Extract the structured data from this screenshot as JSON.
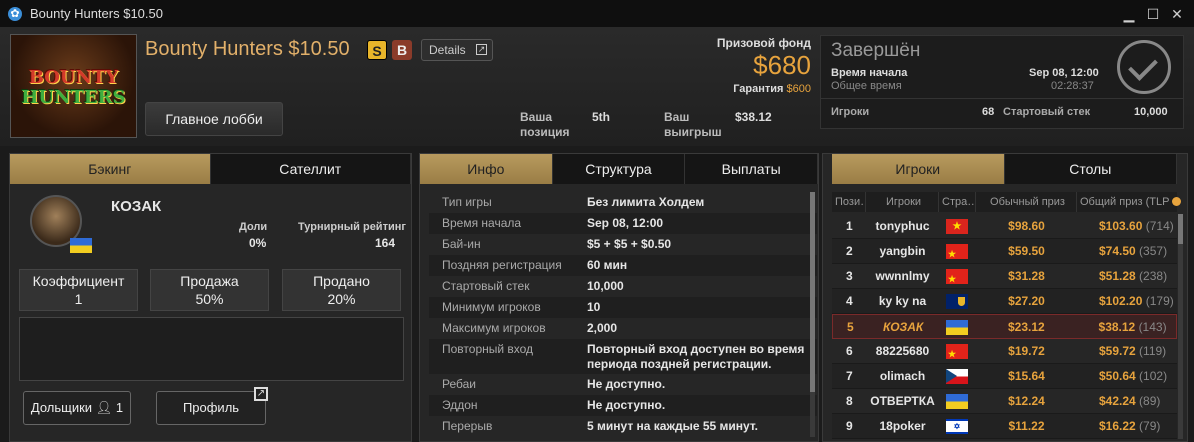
{
  "window": {
    "title": "Bounty Hunters $10.50",
    "minimize": "▁",
    "maximize": "☐",
    "close": "✕"
  },
  "logo": {
    "line1": "BOUNTY",
    "line2": "HUNTERS"
  },
  "header": {
    "tournament_name": "Bounty Hunters $10.50",
    "badge_s": "S",
    "badge_b": "B",
    "details_label": "Details",
    "lobby_button": "Главное лобби",
    "position_label_1": "Ваша",
    "position_label_2": "позиция",
    "position_value": "5th",
    "winnings_label_1": "Ваш",
    "winnings_label_2": "выигрыш",
    "winnings_value": "$38.12",
    "prize_label": "Призовой фонд",
    "prize_value": "$680",
    "guarantee_label": "Гарантия",
    "guarantee_value": "$600"
  },
  "status": {
    "title": "Завершён",
    "start_label": "Время начала",
    "start_value": "Sep 08, 12:00",
    "total_label": "Общее время",
    "total_value": "02:28:37",
    "players_label": "Игроки",
    "players_value": "68",
    "stack_label": "Стартовый стек",
    "stack_value": "10,000"
  },
  "left_panel": {
    "tabs": [
      "Бэкинг",
      "Сателлит"
    ],
    "player_name": "КОЗАК",
    "shares_label": "Доли",
    "shares_value": "0%",
    "rating_label": "Турнирный рейтинг",
    "rating_value": "164",
    "stats": [
      {
        "label": "Коэффициент",
        "value": "1"
      },
      {
        "label": "Продажа",
        "value": "50%"
      },
      {
        "label": "Продано",
        "value": "20%"
      }
    ],
    "backers_button": "Дольщики",
    "backers_count": "1",
    "profile_button": "Профиль"
  },
  "mid_panel": {
    "tabs": [
      "Инфо",
      "Структура",
      "Выплаты"
    ],
    "rows": [
      {
        "k": "Тип игры",
        "v": "Без лимита Холдем"
      },
      {
        "k": "Время начала",
        "v": "Sep 08, 12:00"
      },
      {
        "k": "Бай-ин",
        "v": "$5 + $5 + $0.50"
      },
      {
        "k": "Поздняя регистрация",
        "v": "60 мин"
      },
      {
        "k": "Стартовый стек",
        "v": "10,000"
      },
      {
        "k": "Минимум игроков",
        "v": "10"
      },
      {
        "k": "Максимум игроков",
        "v": "2,000"
      },
      {
        "k": "Повторный вход",
        "v": "Повторный вход доступен во время периода поздней регистрации."
      },
      {
        "k": "Ребаи",
        "v": "Не доступно."
      },
      {
        "k": "Эддон",
        "v": "Не доступно."
      },
      {
        "k": "Перерыв",
        "v": "5 минут на каждые 55 минут."
      }
    ]
  },
  "right_panel": {
    "tabs": [
      "Игроки",
      "Столы"
    ],
    "columns": [
      "Пози…",
      "Игроки",
      "Стра…",
      "Обычный приз",
      "Общий приз (TLP"
    ],
    "rows": [
      {
        "pos": "1",
        "name": "tonyphuc",
        "flag": "vn",
        "prize": "$98.60",
        "total": "$103.60",
        "tlp": "(714)"
      },
      {
        "pos": "2",
        "name": "yangbin",
        "flag": "cn",
        "prize": "$59.50",
        "total": "$74.50",
        "tlp": "(357)"
      },
      {
        "pos": "3",
        "name": "wwnnlmy",
        "flag": "cn",
        "prize": "$31.28",
        "total": "$51.28",
        "tlp": "(238)"
      },
      {
        "pos": "4",
        "name": "ky ky na",
        "flag": "ms",
        "prize": "$27.20",
        "total": "$102.20",
        "tlp": "(179)"
      },
      {
        "pos": "5",
        "name": "КОЗАК",
        "flag": "ua",
        "prize": "$23.12",
        "total": "$38.12",
        "tlp": "(143)"
      },
      {
        "pos": "6",
        "name": "88225680",
        "flag": "cn",
        "prize": "$19.72",
        "total": "$59.72",
        "tlp": "(119)"
      },
      {
        "pos": "7",
        "name": "olimach",
        "flag": "cz",
        "prize": "$15.64",
        "total": "$50.64",
        "tlp": "(102)"
      },
      {
        "pos": "8",
        "name": "ОТВЕРТКА",
        "flag": "ua",
        "prize": "$12.24",
        "total": "$42.24",
        "tlp": "(89)"
      },
      {
        "pos": "9",
        "name": "18poker",
        "flag": "il",
        "prize": "$11.22",
        "total": "$16.22",
        "tlp": "(79)"
      }
    ]
  }
}
